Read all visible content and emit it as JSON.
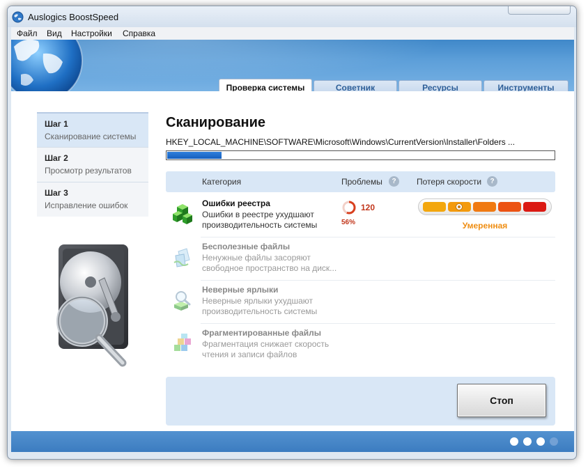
{
  "window": {
    "title": "Auslogics BoostSpeed"
  },
  "menu": [
    "Файл",
    "Вид",
    "Настройки",
    "Справка"
  ],
  "tabs": [
    {
      "label": "Проверка системы",
      "active": true
    },
    {
      "label": "Советник",
      "active": false
    },
    {
      "label": "Ресурсы",
      "active": false
    },
    {
      "label": "Инструменты",
      "active": false
    }
  ],
  "steps": [
    {
      "title": "Шаг 1",
      "subtitle": "Сканирование системы",
      "active": true
    },
    {
      "title": "Шаг 2",
      "subtitle": "Просмотр результатов",
      "active": false
    },
    {
      "title": "Шаг 3",
      "subtitle": "Исправление ошибок",
      "active": false
    }
  ],
  "scan": {
    "title": "Сканирование",
    "path": "HKEY_LOCAL_MACHINE\\SOFTWARE\\Microsoft\\Windows\\CurrentVersion\\Installer\\Folders ...",
    "progress_fraction": 0.14
  },
  "columns": {
    "category": "Категория",
    "problems": "Проблемы",
    "speed_loss": "Потеря скорости",
    "help_glyph": "?"
  },
  "categories": [
    {
      "name": "Ошибки реестра",
      "desc_line1": "Ошибки в реестре ухудшают",
      "desc_line2": "производительность системы",
      "problems": "120",
      "percent": "56%",
      "speed_level": "Умеренная",
      "speed_level_index": 2,
      "icon": "registry-cubes-icon",
      "active": true
    },
    {
      "name": "Бесполезные файлы",
      "desc_line1": "Ненужные файлы засоряют",
      "desc_line2": "свободное пространство на диск...",
      "icon": "junk-files-icon",
      "active": false
    },
    {
      "name": "Неверные ярлыки",
      "desc_line1": "Неверные ярлыки ухудшают",
      "desc_line2": "производительность системы",
      "icon": "shortcut-search-icon",
      "active": false
    },
    {
      "name": "Фрагментированные файлы",
      "desc_line1": "Фрагментация снижает скорость",
      "desc_line2": "чтения и записи файлов",
      "icon": "fragmented-blocks-icon",
      "active": false
    }
  ],
  "stop_button": "Стоп",
  "meter_colors": [
    "#f3a70e",
    "#f39a0e",
    "#f07a12",
    "#ec5313",
    "#db1a13"
  ],
  "pager": {
    "total": 4,
    "active_index": 3
  },
  "colors": {
    "accent_blue": "#3f88c9",
    "panel_blue": "#d9e7f6",
    "problem_red": "#c2371c",
    "level_orange": "#ef8d12"
  }
}
